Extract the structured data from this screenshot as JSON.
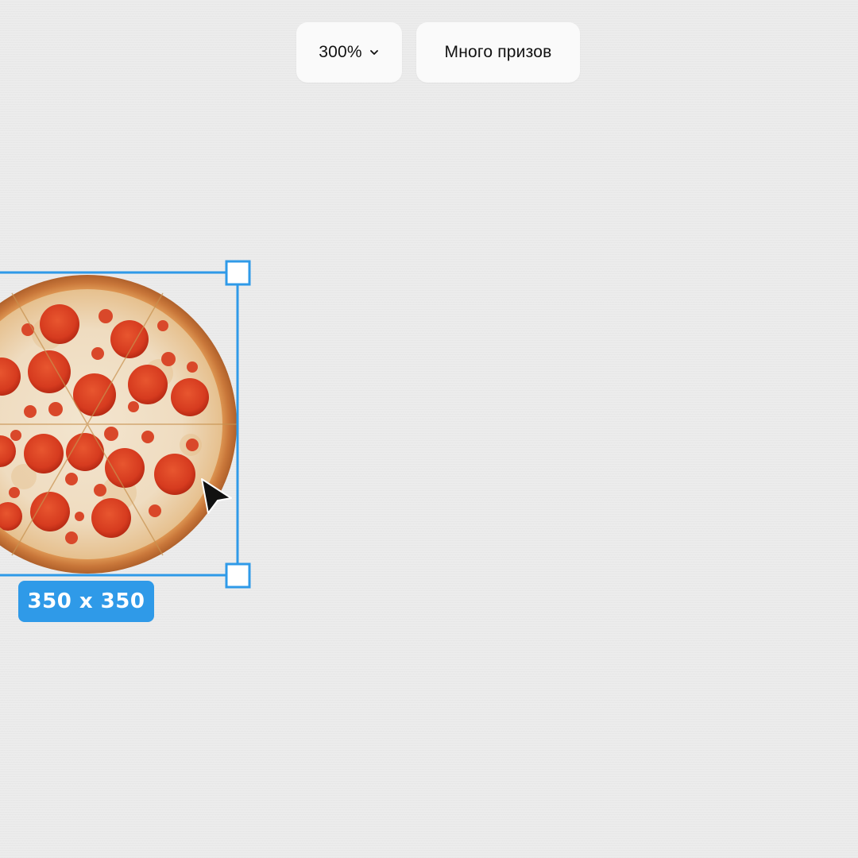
{
  "toolbar": {
    "zoom_label": "300%",
    "prizes_label": "Много призов"
  },
  "selection": {
    "size_label": "350 x 350"
  },
  "icons": {
    "zoom_dropdown": "chevron-down-icon",
    "pointer": "cursor-arrow-icon"
  },
  "colors": {
    "background": "#ececec",
    "selection_accent": "#2f9ae8",
    "pill_background": "#fafafa"
  }
}
